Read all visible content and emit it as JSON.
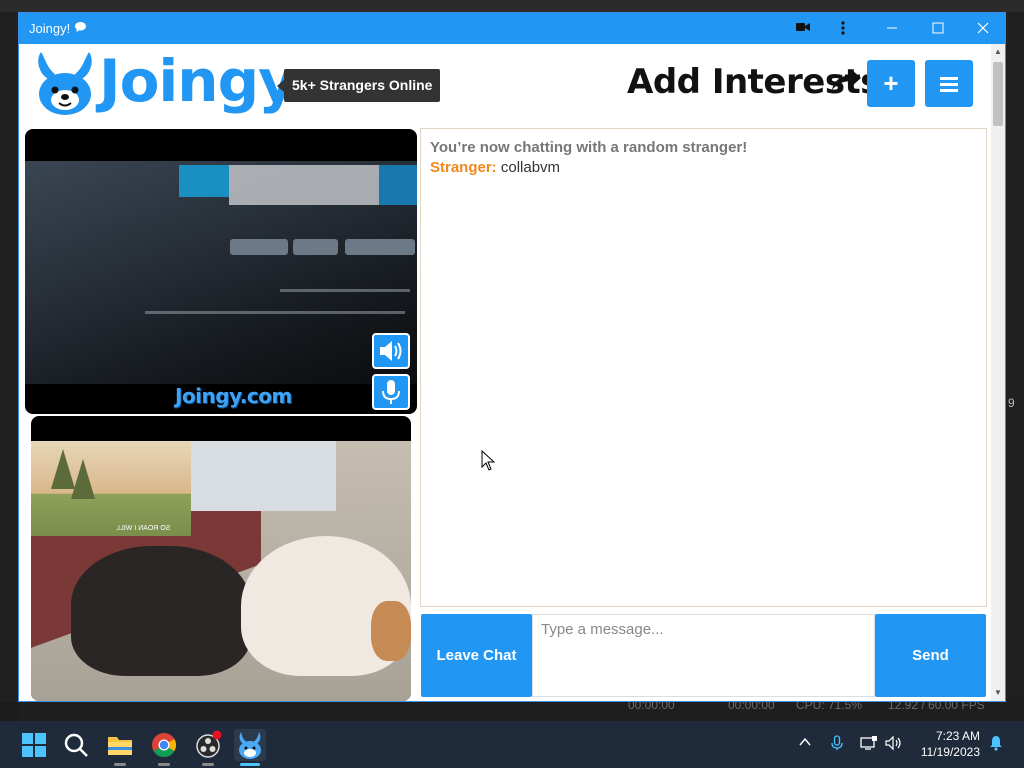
{
  "background": {
    "status_fields": [
      "00:00:00",
      "00:00:00",
      "CPU: 71.5%",
      "12.92 / 60.00 FPS"
    ],
    "side_digit": "9"
  },
  "window": {
    "title": "Joingy!",
    "accent": "#2196f3"
  },
  "header": {
    "logo_text": "Joingy",
    "online_badge": "5k+ Strangers Online",
    "add_interests": "Add Interests",
    "plus_label": "+",
    "menu_label": "≡"
  },
  "video": {
    "watermark": "Joingy.com",
    "pip_caption": "SO ROAN I WILL"
  },
  "chat": {
    "status": "You’re now chatting with a random stranger!",
    "messages": [
      {
        "sender": "Stranger:",
        "text": "collabvm"
      }
    ],
    "leave_label": "Leave Chat",
    "input_placeholder": "Type a message...",
    "input_value": "",
    "send_label": "Send"
  },
  "taskbar": {
    "time": "7:23 AM",
    "date": "11/19/2023"
  }
}
